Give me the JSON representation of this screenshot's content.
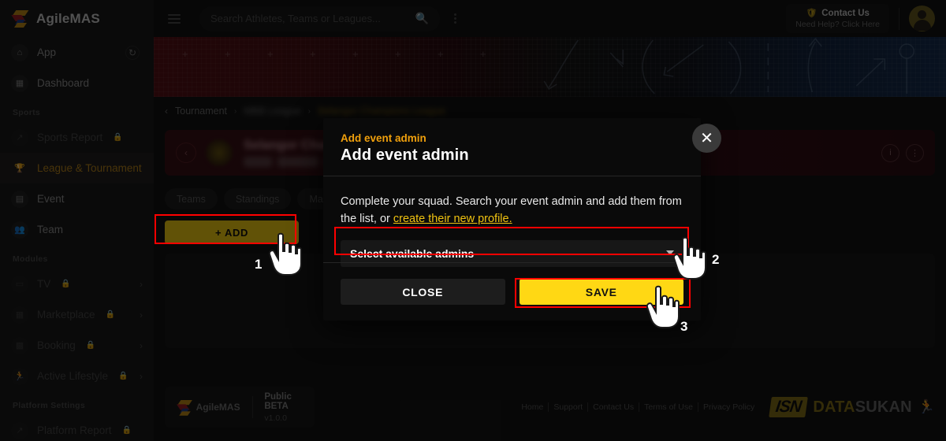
{
  "brand": {
    "name": "AgileMAS"
  },
  "sidebar": {
    "items": [
      {
        "label": "App",
        "icon": "home-icon",
        "state": "normal",
        "trailing": "refresh-icon"
      },
      {
        "label": "Dashboard",
        "icon": "grid-icon",
        "state": "normal",
        "trailing": ""
      },
      {
        "label": "Sports",
        "icon": "",
        "state": "group",
        "trailing": ""
      },
      {
        "label": "Sports Report",
        "icon": "trend-icon",
        "state": "locked",
        "trailing": ""
      },
      {
        "label": "League & Tournament",
        "icon": "trophy-icon",
        "state": "active",
        "trailing": ""
      },
      {
        "label": "Event",
        "icon": "ticket-icon",
        "state": "normal",
        "trailing": ""
      },
      {
        "label": "Team",
        "icon": "people-icon",
        "state": "normal",
        "trailing": ""
      },
      {
        "label": "Modules",
        "icon": "",
        "state": "group",
        "trailing": ""
      },
      {
        "label": "TV",
        "icon": "tv-icon",
        "state": "locked",
        "trailing": "chevron-right-icon"
      },
      {
        "label": "Marketplace",
        "icon": "store-icon",
        "state": "locked",
        "trailing": "chevron-right-icon"
      },
      {
        "label": "Booking",
        "icon": "building-icon",
        "state": "locked",
        "trailing": "chevron-right-icon"
      },
      {
        "label": "Active Lifestyle",
        "icon": "runner-icon",
        "state": "locked",
        "trailing": "chevron-right-icon"
      },
      {
        "label": "Platform Settings",
        "icon": "",
        "state": "group",
        "trailing": ""
      },
      {
        "label": "Platform Report",
        "icon": "trend-icon",
        "state": "locked",
        "trailing": ""
      }
    ]
  },
  "topbar": {
    "menu_icon": "hamburger-icon",
    "search": {
      "placeholder": "Search Athletes, Teams or Leagues...",
      "value": "",
      "icon": "search-icon"
    },
    "more_icon": "kebab-icon",
    "contact": {
      "title": "Contact Us",
      "subtitle": "Need Help? Click Here",
      "icon": "shield-icon"
    },
    "avatar": "user-avatar"
  },
  "breadcrumb": {
    "back_icon": "chevron-left-icon",
    "items": [
      "Tournament",
      "MBB League",
      "Selangor Champions League"
    ],
    "separator": "›"
  },
  "tournament_card": {
    "back_icon": "chevron-left-icon",
    "title": "Selangor Champions League",
    "info_icon": "info-icon",
    "more_icon": "kebab-icon"
  },
  "tabs": [
    {
      "label": "Teams"
    },
    {
      "label": "Standings"
    },
    {
      "label": "Matches"
    }
  ],
  "add_button": {
    "label": "+  ADD"
  },
  "modal": {
    "kicker": "Add event admin",
    "title": "Add event admin",
    "close_icon": "close-icon",
    "description_lead": "Complete your squad. Search your event admin and add them from the list, or ",
    "description_link": "create their new profile.",
    "select": {
      "value": "Select available admins",
      "caret_icon": "chevron-down-icon",
      "options": [
        "Select available admins"
      ]
    },
    "close_label": "CLOSE",
    "save_label": "SAVE"
  },
  "annotations": {
    "step1": "1",
    "step2": "2",
    "step3": "3"
  },
  "footer": {
    "brand": "AgileMAS",
    "beta": "Public BETA",
    "version": "v1.0.0",
    "links": [
      "Home",
      "Support",
      "Contact Us",
      "Terms of Use",
      "Privacy Policy"
    ],
    "partner": {
      "isn": "ISN",
      "data": "DATA",
      "sukan": "SUKAN"
    }
  },
  "colors": {
    "accent_yellow": "#FFD814",
    "accent_orange": "#F0A00C",
    "highlight_red": "#FF0000",
    "sidebar_active": "#c08a1c"
  }
}
